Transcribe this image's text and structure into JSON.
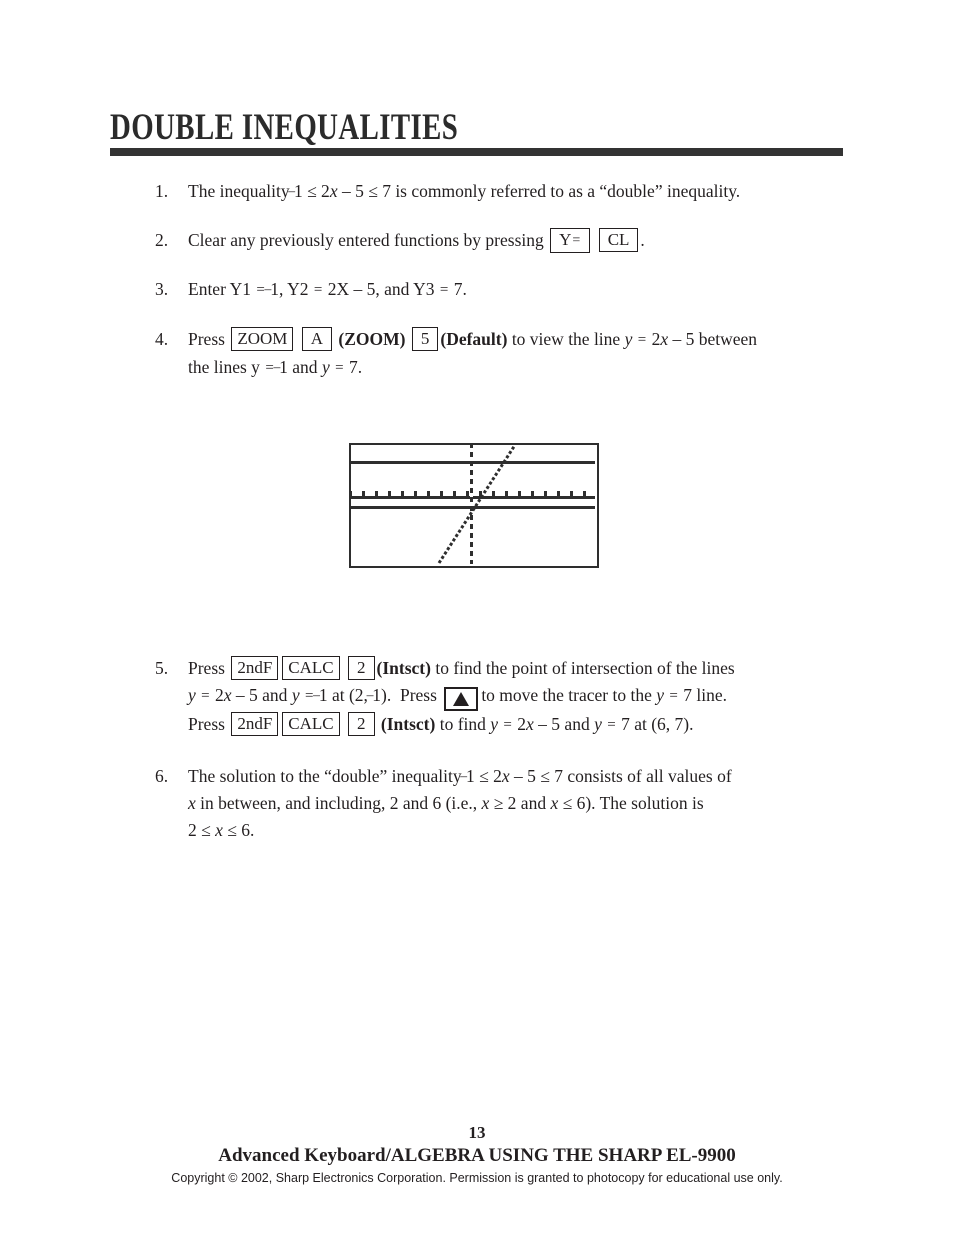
{
  "document": {
    "title": "DOUBLE INEQUALITIES"
  },
  "steps": [
    {
      "number": "1.",
      "text_before": "The inequality ",
      "neg_one": "1",
      "mid": " ≤ 2",
      "x1": "x",
      "after_x": " – 5 ≤ 7 is commonly referred to as a “double” inequality."
    },
    {
      "number": "2.",
      "text_before": "Clear any previously entered functions by pressing",
      "key1": "Y",
      "key1_eq": "=",
      "key2": "CL",
      "text_after": "."
    },
    {
      "number": "3.",
      "text": "Enter Y1 ",
      "eq1": "=",
      "neg_one": "1",
      "mid": ", Y2 ",
      "eq2": "=",
      "expr": " 2X – 5, and Y3 ",
      "eq3": "=",
      "end": " 7."
    },
    {
      "number": "4.",
      "press": "Press",
      "key_zoom": "ZOOM",
      "key_a": "A",
      "label_zoom": "(ZOOM)",
      "key_5": "5",
      "label_default": "(Default)",
      "text_mid": "to view the line ",
      "y": "y",
      "eq": "=",
      "expr": " 2",
      "x": "x",
      "expr2": " – 5 between",
      "line2_a": "the lines y ",
      "line2_eq1": "=",
      "line2_neg": "1",
      "line2_b": " and ",
      "line2_y": "y",
      "line2_eq2": "=",
      "line2_c": " 7."
    },
    {
      "number": "5.",
      "press": "Press",
      "key_2ndf": "2ndF",
      "key_calc": "CALC",
      "key_2": "2",
      "label_intsct": "(Intsct)",
      "text_1": "to find the point of intersection of the lines",
      "l2_y": "y",
      "l2_eq1": "=",
      "l2_expr": " 2",
      "l2_x": "x",
      "l2_expr2": " – 5 and ",
      "l2_y2": "y",
      "l2_eq2": "=",
      "l2_neg": "1",
      "l2_at": " at (2, ",
      "l2_neg2": "1",
      "l2_close": ").",
      "l2_press": "Press",
      "arrow_key": "▲",
      "l2_tail": "to move the tracer to the ",
      "l2_y3": "y",
      "l2_eq3": "=",
      "l2_tail2": " 7 line.",
      "l3_press": "Press",
      "l3_key_2ndf": "2ndF",
      "l3_key_calc": "CALC",
      "l3_key_2": "2",
      "l3_label": "(Intsct)",
      "l3_text": "to find ",
      "l3_y": "y",
      "l3_eq1": "=",
      "l3_expr": " 2",
      "l3_x": "x",
      "l3_expr2": " – 5 and ",
      "l3_y2": "y",
      "l3_eq2": "=",
      "l3_end": " 7 at (6, 7)."
    },
    {
      "number": "6.",
      "l1_a": "The solution to the “double” inequality ",
      "l1_neg": "1",
      "l1_b": " ≤ 2",
      "l1_x": "x",
      "l1_c": " – 5 ≤ 7 consists of all values of",
      "l2_x": "x",
      "l2_a": " in between, and including, 2 and 6 (i.e., ",
      "l2_x2": "x",
      "l2_b": " ≥ 2 and ",
      "l2_x3": "x",
      "l2_c": " ≤ 6).  The solution is",
      "l3_a": "2 ≤ ",
      "l3_x": "x",
      "l3_b": " ≤ 6."
    }
  ],
  "graph": {
    "description": "Sharp EL-9900 graphing screen showing y = 2x - 5 crossing the horizontal lines y = -1 and y = 7",
    "lines": [
      "y = 7",
      "y = -1",
      "y = 2x - 5"
    ],
    "intersections": [
      "(2, -1)",
      "(6, 7)"
    ]
  },
  "footer": {
    "page_number": "13",
    "title": "Advanced Keyboard/ALGEBRA USING THE SHARP EL-9900",
    "copyright": "Copyright © 2002, Sharp Electronics Corporation.  Permission is granted to photocopy for educational use only."
  }
}
